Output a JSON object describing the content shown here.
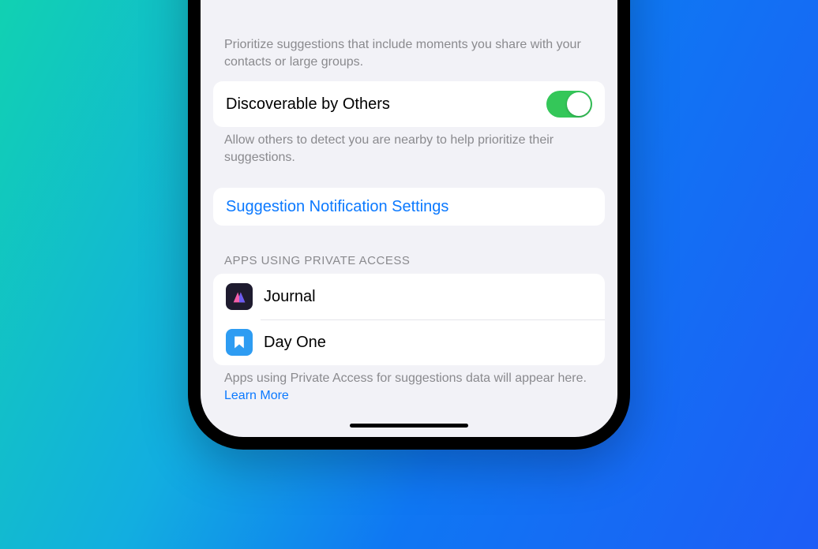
{
  "prioritize_caption": "Prioritize suggestions that include moments you share with your contacts or large groups.",
  "discoverable": {
    "label": "Discoverable by Others",
    "caption": "Allow others to detect you are nearby to help prioritize their suggestions.",
    "enabled": true
  },
  "notification_link": "Suggestion Notification Settings",
  "apps_section": {
    "header": "APPS USING PRIVATE ACCESS",
    "items": [
      {
        "name": "Journal"
      },
      {
        "name": "Day One"
      }
    ],
    "footer_text": "Apps using Private Access for suggestions data will appear here. ",
    "footer_link": "Learn More"
  },
  "colors": {
    "toggle_on": "#34c759",
    "link": "#0b79ff"
  }
}
